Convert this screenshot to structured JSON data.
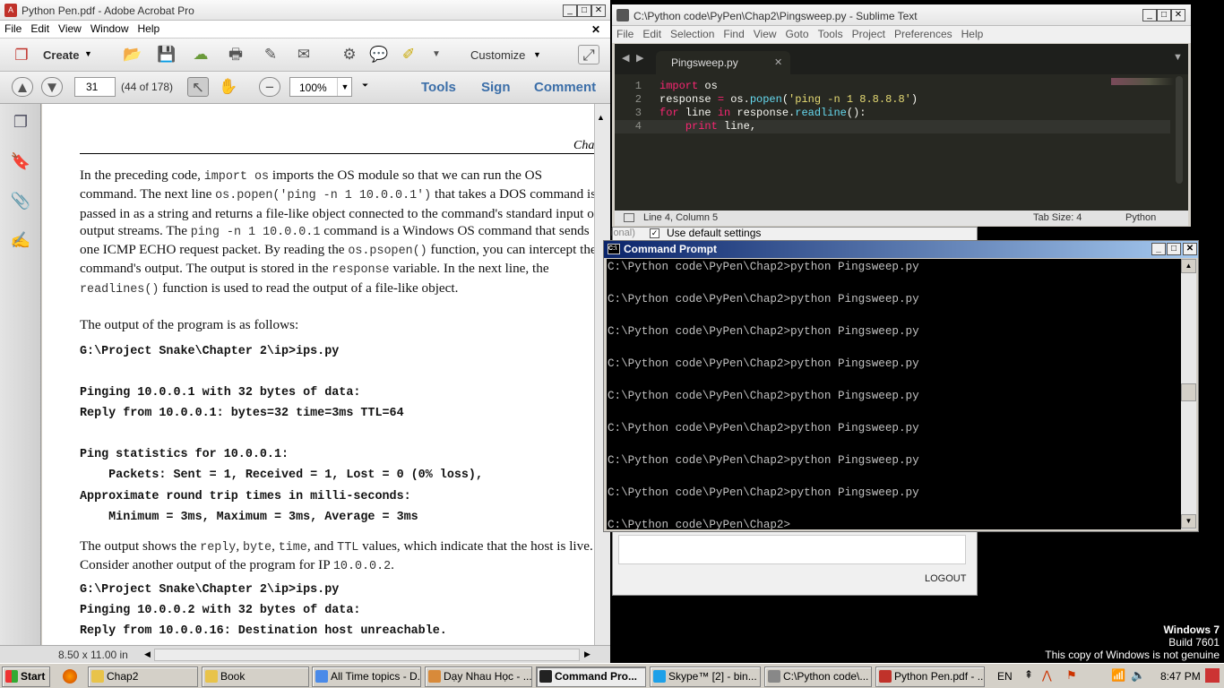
{
  "acrobat": {
    "title": "Python Pen.pdf - Adobe Acrobat Pro",
    "menu": [
      "File",
      "Edit",
      "View",
      "Window",
      "Help"
    ],
    "create_label": "Create",
    "customize_label": "Customize",
    "page_number": "31",
    "page_count": "(44 of 178)",
    "zoom": "100%",
    "links": {
      "tools": "Tools",
      "sign": "Sign",
      "comment": "Comment"
    },
    "page_size": "8.50 x 11.00 in",
    "header_fragment": "Cha",
    "paragraph1": [
      {
        "t": "In the preceding code, "
      },
      {
        "c": "import os"
      },
      {
        "t": " imports the OS module so that we can run the OS command. The next line "
      },
      {
        "c": "os.popen('ping -n 1 10.0.0.1')"
      },
      {
        "t": " that takes a DOS command is passed in as a string and returns a file-like object connected to the command's standard input or output streams. The "
      },
      {
        "c": "ping -n 1 10.0.0.1"
      },
      {
        "t": " command is a Windows OS command that sends one ICMP ECHO request packet. By reading the "
      },
      {
        "c": "os.psopen()"
      },
      {
        "t": " function, you can intercept the command's output. The output is stored in the "
      },
      {
        "c": "response"
      },
      {
        "t": " variable. In the next line, the "
      },
      {
        "c": "readlines()"
      },
      {
        "t": " function is used to read the output of a file-like object."
      }
    ],
    "paragraph2": "The output of the program is as follows:",
    "code1": [
      "G:\\Project Snake\\Chapter 2\\ip>ips.py",
      "",
      "Pinging 10.0.0.1 with 32 bytes of data:",
      "Reply from 10.0.0.1: bytes=32 time=3ms TTL=64",
      "",
      "Ping statistics for 10.0.0.1:",
      "    Packets: Sent = 1, Received = 1, Lost = 0 (0% loss),",
      "Approximate round trip times in milli-seconds:",
      "    Minimum = 3ms, Maximum = 3ms, Average = 3ms"
    ],
    "paragraph3": [
      {
        "t": "The output shows the "
      },
      {
        "c": "reply"
      },
      {
        "t": ", "
      },
      {
        "c": "byte"
      },
      {
        "t": ", "
      },
      {
        "c": "time"
      },
      {
        "t": ", and "
      },
      {
        "c": "TTL"
      },
      {
        "t": " values, which indicate that the host is live. Consider another output of the program for IP "
      },
      {
        "c": "10.0.0.2"
      },
      {
        "t": "."
      }
    ],
    "code2": [
      "G:\\Project Snake\\Chapter 2\\ip>ips.py",
      "Pinging 10.0.0.2 with 32 bytes of data:",
      "Reply from 10.0.0.16: Destination host unreachable."
    ]
  },
  "sublime": {
    "title": "C:\\Python code\\PyPen\\Chap2\\Pingsweep.py - Sublime Text",
    "menu": [
      "File",
      "Edit",
      "Selection",
      "Find",
      "View",
      "Goto",
      "Tools",
      "Project",
      "Preferences",
      "Help"
    ],
    "tab": "Pingsweep.py",
    "code": [
      [
        {
          "k": "kw",
          "v": "import"
        },
        {
          "v": " os"
        }
      ],
      [
        {
          "v": "response "
        },
        {
          "k": "kw",
          "v": "="
        },
        {
          "v": " os."
        },
        {
          "k": "fn",
          "v": "popen"
        },
        {
          "v": "("
        },
        {
          "k": "str",
          "v": "'ping -n 1 8.8.8.8'"
        },
        {
          "v": ")"
        }
      ],
      [
        {
          "k": "kw",
          "v": "for"
        },
        {
          "v": " line "
        },
        {
          "k": "kw",
          "v": "in"
        },
        {
          "v": " response."
        },
        {
          "k": "fn",
          "v": "readline"
        },
        {
          "v": "():"
        }
      ],
      [
        {
          "v": "    "
        },
        {
          "k": "kw",
          "v": "print"
        },
        {
          "v": " line,"
        }
      ]
    ],
    "status_left": "Line 4, Column 5",
    "tab_size": "Tab Size: 4",
    "syntax": "Python"
  },
  "dialog": {
    "partial_label": "ional)",
    "checkbox_label": "Use default settings",
    "logout": "LOGOUT"
  },
  "cmd": {
    "title": "Command Prompt",
    "lines": [
      "C:\\Python code\\PyPen\\Chap2>python Pingsweep.py",
      "",
      "C:\\Python code\\PyPen\\Chap2>python Pingsweep.py",
      "",
      "C:\\Python code\\PyPen\\Chap2>python Pingsweep.py",
      "",
      "C:\\Python code\\PyPen\\Chap2>python Pingsweep.py",
      "",
      "C:\\Python code\\PyPen\\Chap2>python Pingsweep.py",
      "",
      "C:\\Python code\\PyPen\\Chap2>python Pingsweep.py",
      "",
      "C:\\Python code\\PyPen\\Chap2>python Pingsweep.py",
      "",
      "C:\\Python code\\PyPen\\Chap2>python Pingsweep.py",
      "",
      "C:\\Python code\\PyPen\\Chap2>"
    ]
  },
  "watermark": {
    "line1": "Windows 7",
    "line2": "Build 7601",
    "line3": "This copy of Windows is not genuine"
  },
  "taskbar": {
    "start": "Start",
    "buttons": [
      {
        "label": "Chap2",
        "color": "#e8c34a"
      },
      {
        "label": "Book",
        "color": "#e8c34a"
      },
      {
        "label": "All Time topics - D...",
        "color": "#4a8ae8"
      },
      {
        "label": "Dạy Nhau Học - ...",
        "color": "#d88a3a"
      },
      {
        "label": "Command Pro...",
        "color": "#222222"
      },
      {
        "label": "Skype™ [2] - bin...",
        "color": "#1ea0e8"
      },
      {
        "label": "C:\\Python code\\...",
        "color": "#888888"
      },
      {
        "label": "Python Pen.pdf - ...",
        "color": "#c0322a"
      }
    ],
    "lang": "EN",
    "time": "8:47 PM"
  }
}
